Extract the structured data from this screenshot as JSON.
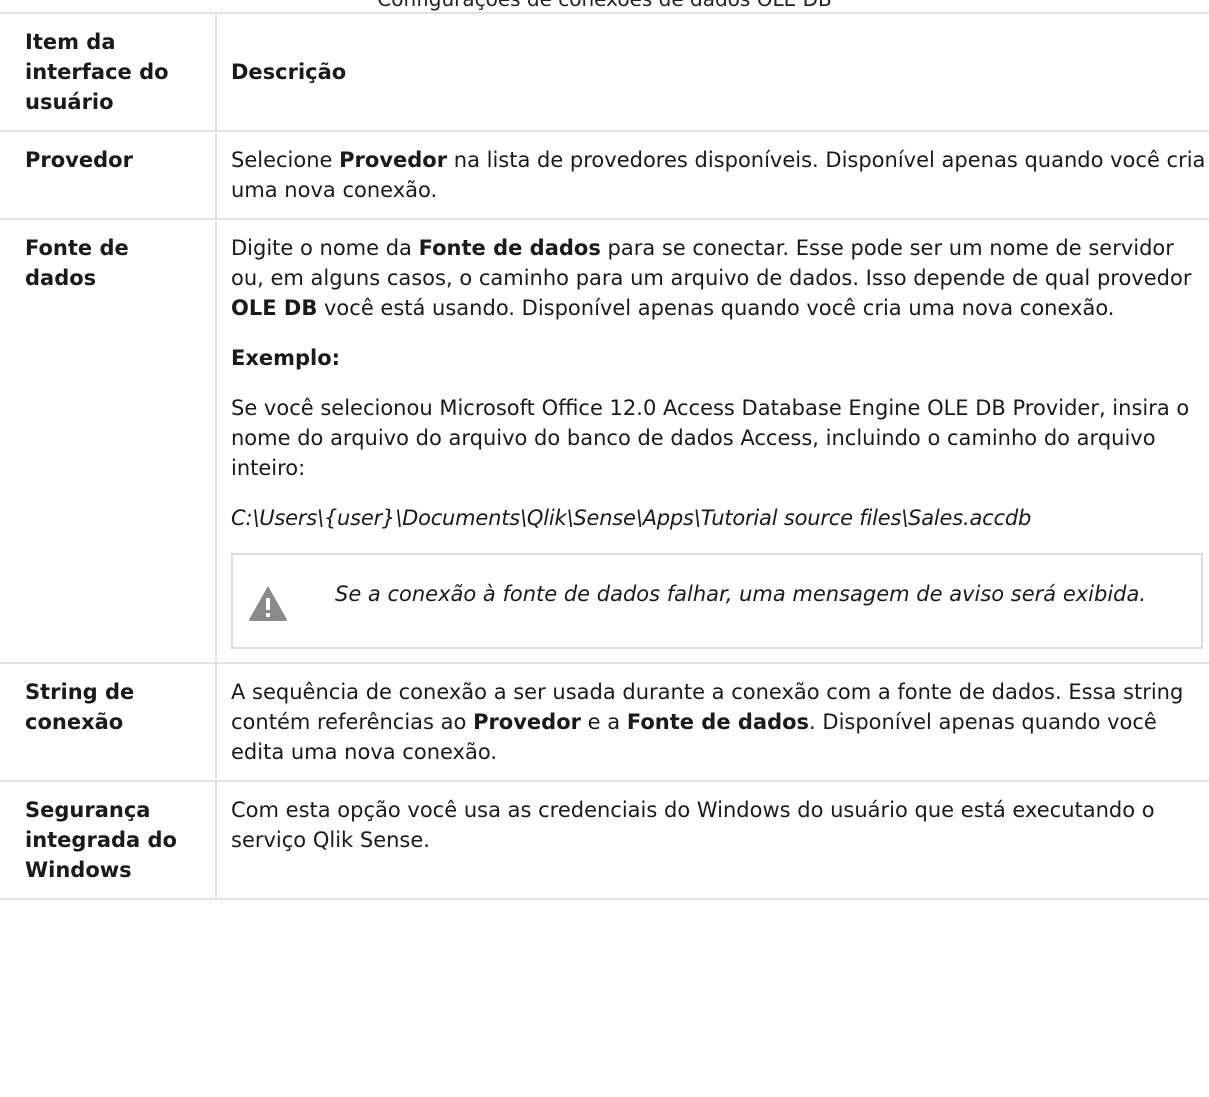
{
  "caption": "Configurações de conexões de dados OLE DB",
  "table": {
    "headers": [
      "Item da interface do usuário",
      "Descrição"
    ],
    "rows": [
      {
        "item": "Provedor",
        "desc": {
          "t1": "Selecione ",
          "b1": "Provedor",
          "t2": " na lista de provedores disponíveis. Disponível apenas quando você cria uma nova conexão."
        }
      },
      {
        "item": "Fonte de dados",
        "desc": {
          "t1": "Digite o nome da ",
          "b1": "Fonte de dados",
          "t2": " para se conectar. Esse pode ser um nome de servidor ou, em alguns casos, o caminho para um arquivo de dados. Isso depende de qual provedor ",
          "b2": "OLE DB",
          "t3": " você está usando. Disponível apenas quando você cria uma nova conexão.",
          "example_label": "Exemplo:",
          "example_text": "Se você selecionou Microsoft Office 12.0 Access Database Engine OLE DB Provider, insira o nome do arquivo do arquivo do banco de dados Access, incluindo o caminho do arquivo inteiro:",
          "example_path": "C:\\Users\\{user}\\Documents\\Qlik\\Sense\\Apps\\Tutorial source files\\Sales.accdb",
          "note": "Se a conexão à fonte de dados falhar, uma mensagem de aviso será exibida.",
          "note_icon": "warning-icon"
        }
      },
      {
        "item": "String de conexão",
        "desc": {
          "t1": "A sequência de conexão a ser usada durante a conexão com a fonte de dados. Essa string contém referências ao ",
          "b1": "Provedor",
          "t2": " e a ",
          "b2": "Fonte de dados",
          "t3": ". Disponível apenas quando você edita uma nova conexão."
        }
      },
      {
        "item": "Segurança integrada do Windows",
        "desc": {
          "t1": "Com esta opção você usa as credenciais do Windows do usuário que está executando o serviço Qlik Sense."
        }
      }
    ]
  },
  "colors": {
    "border": "#e3e3e3",
    "icon": "#8a8a8a"
  }
}
